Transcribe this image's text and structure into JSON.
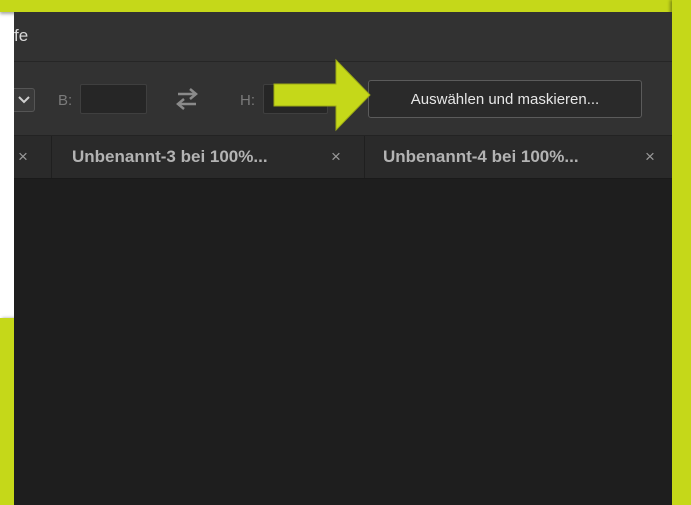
{
  "menubar": {
    "partial_item": "fe"
  },
  "options_bar": {
    "width_label": "B:",
    "width_value": "",
    "height_label": "H:",
    "height_value": "",
    "select_and_mask_label": "Auswählen und maskieren..."
  },
  "tabs": [
    {
      "label": "",
      "close": "×"
    },
    {
      "label": "Unbenannt-3 bei 100%...",
      "close": "×"
    },
    {
      "label": "Unbenannt-4 bei 100%...",
      "close": "×"
    }
  ],
  "annotation": {
    "highlight_color": "#c5d819"
  }
}
